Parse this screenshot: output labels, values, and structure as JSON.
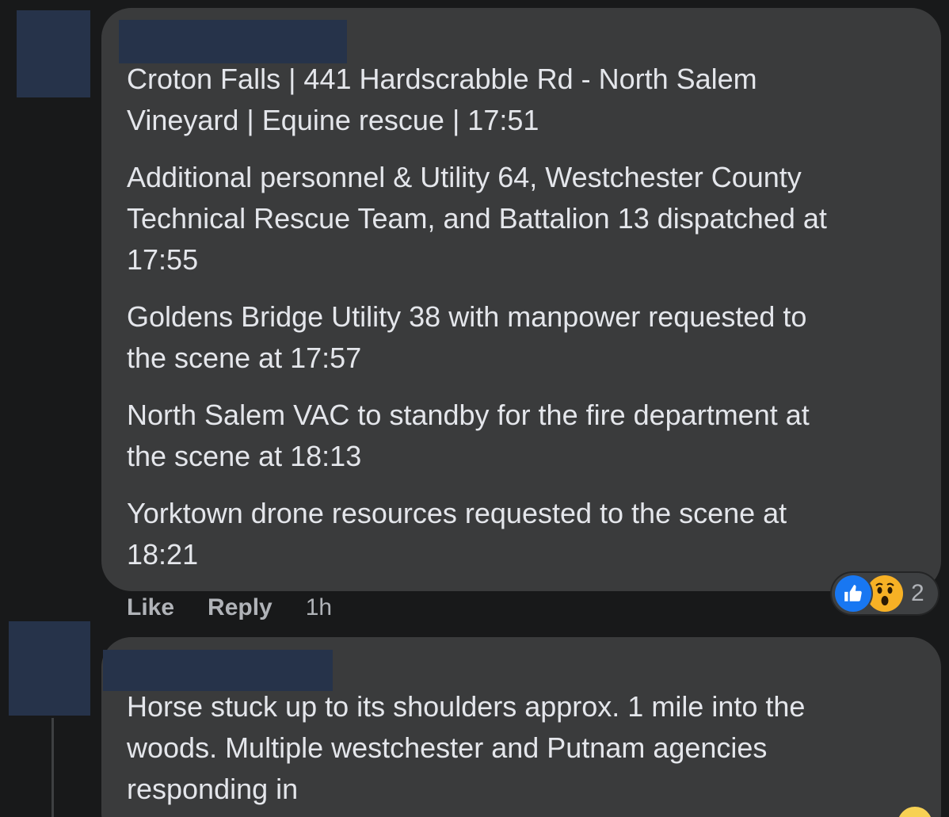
{
  "comments": [
    {
      "paragraphs": [
        "Croton Falls | 441 Hardscrabble Rd - North Salem\nVineyard | Equine rescue | 17:51",
        "Additional personnel & Utility 64, Westchester County\nTechnical Rescue Team, and Battalion 13 dispatched at\n17:55",
        "Goldens Bridge Utility 38 with manpower requested to\nthe scene at 17:57",
        "North Salem VAC to standby for the fire department at\nthe scene at 18:13",
        "Yorktown drone resources requested to the scene at\n18:21"
      ],
      "actions": {
        "like_label": "Like",
        "reply_label": "Reply",
        "timestamp": "1h"
      },
      "reactions": {
        "icons": [
          "like-icon",
          "wow-icon"
        ],
        "count": "2"
      }
    },
    {
      "paragraphs": [
        "Horse stuck up to its shoulders approx. 1 mile into the\nwoods. Multiple westchester and Putnam agencies\nresponding in"
      ]
    }
  ],
  "colors": {
    "background": "#18191a",
    "bubble": "#3a3b3c",
    "text": "#e4e6eb",
    "secondary_text": "#b0b3b8",
    "redacted": "#26334a",
    "like_blue": "#1877f2",
    "wow_yellow": "#f7b125"
  }
}
